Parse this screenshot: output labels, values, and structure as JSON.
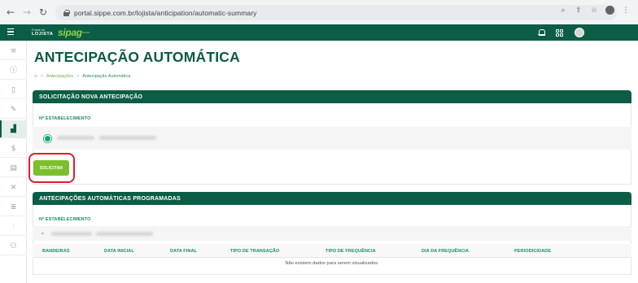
{
  "browser": {
    "url": "portal.sippe.com.br/lojista/anticipation/automatic-summary",
    "back_icon": "arrow-left",
    "forward_icon": "arrow-right",
    "reload_icon": "reload",
    "lock_icon": "lock",
    "zoom_icon": "magnifier",
    "share_icon": "share",
    "bookmark_icon": "star",
    "menu_icon": "kebab"
  },
  "header": {
    "portal_label_top": "Portal do",
    "portal_label_bottom": "LOJISTA",
    "logo_text": "sipag",
    "brand_color": "#0c5d45",
    "logo_color": "#8fd640"
  },
  "sidebar": {
    "items": [
      {
        "icon": "list-icon",
        "glyph": "≡"
      },
      {
        "icon": "info-icon",
        "glyph": "ⓘ"
      },
      {
        "icon": "document-icon",
        "glyph": "▯"
      },
      {
        "icon": "tools-icon",
        "glyph": "✎"
      },
      {
        "icon": "chart-icon",
        "glyph": "▟",
        "active": true
      },
      {
        "icon": "dollar-icon",
        "glyph": "$"
      },
      {
        "icon": "calendar-icon",
        "glyph": "▤"
      },
      {
        "icon": "wrench-icon",
        "glyph": "✕"
      },
      {
        "icon": "stack-icon",
        "glyph": "≣"
      },
      {
        "icon": "pos-icon",
        "glyph": "⫶"
      },
      {
        "icon": "people-icon",
        "glyph": "⚇"
      }
    ]
  },
  "page": {
    "title": "ANTECIPAÇÃO AUTOMÁTICA",
    "breadcrumb": {
      "home_icon": "home",
      "items": [
        "Antecipações",
        "Antecipação Automática"
      ]
    }
  },
  "new_request": {
    "section_title": "SOLICITAÇÃO NOVA ANTECIPAÇÃO",
    "field_label": "Nº ESTABELECIMENTO",
    "submit_label": "SOLICITAR",
    "radio_selected": true
  },
  "scheduled": {
    "section_title": "ANTECIPAÇÕES AUTOMÁTICAS PROGRAMADAS",
    "field_label": "Nº ESTABELECIMENTO",
    "columns": [
      "BANDEIRAS",
      "DATA INICIAL",
      "DATA FINAL",
      "TIPO DE TRANSAÇÃO",
      "TIPO DE FREQUÊNCIA",
      "DIA DA FREQUÊNCIA",
      "PERIODICIDADE"
    ],
    "empty_message": "Não existem dados para serem visualizados."
  }
}
